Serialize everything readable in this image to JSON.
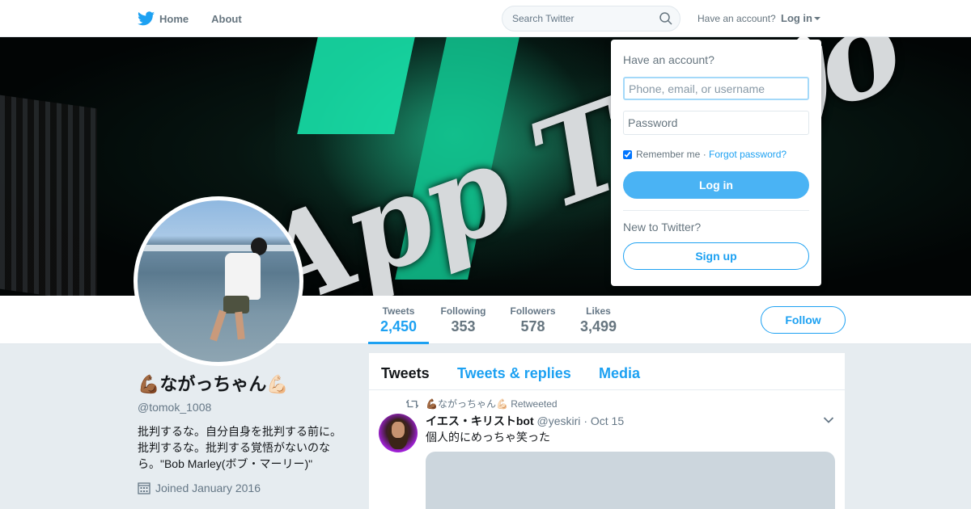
{
  "nav": {
    "home_label": "Home",
    "about_label": "About",
    "search_placeholder": "Search Twitter",
    "have_account_label": "Have an account?",
    "login_label": "Log in",
    "brand_color": "#1da1f2",
    "bird_icon": "twitter-bird-icon",
    "search_icon": "search-icon"
  },
  "banner": {
    "text": "App Tokyo"
  },
  "profile": {
    "display_name": "💪🏾ながっちゃん💪🏻",
    "handle": "@tomok_1008",
    "bio": "批判するな。自分自身を批判する前に。批判するな。批判する覚悟がないのなら。\"Bob Marley(ボブ・マーリー)\"",
    "joined": "Joined January 2016",
    "follow_label": "Follow"
  },
  "stats": [
    {
      "label": "Tweets",
      "value": "2,450",
      "active": true
    },
    {
      "label": "Following",
      "value": "353"
    },
    {
      "label": "Followers",
      "value": "578"
    },
    {
      "label": "Likes",
      "value": "3,499"
    }
  ],
  "timeline": {
    "tabs": [
      "Tweets",
      "Tweets & replies",
      "Media"
    ],
    "active_tab": "Tweets",
    "tweet": {
      "retweeted_by": "💪🏾ながっちゃん💪🏻 Retweeted",
      "name": "イエス・キリストbot",
      "handle": "@yeskiri",
      "separator": "·",
      "date": "Oct 15",
      "text": "個人的にめっちゃ笑った"
    }
  },
  "login_dropdown": {
    "title": "Have an account?",
    "username_placeholder": "Phone, email, or username",
    "password_placeholder": "Password",
    "remember_label": "Remember me",
    "separator": "·",
    "forgot_label": "Forgot password?",
    "login_button": "Log in",
    "new_label": "New to Twitter?",
    "signup_button": "Sign up"
  }
}
